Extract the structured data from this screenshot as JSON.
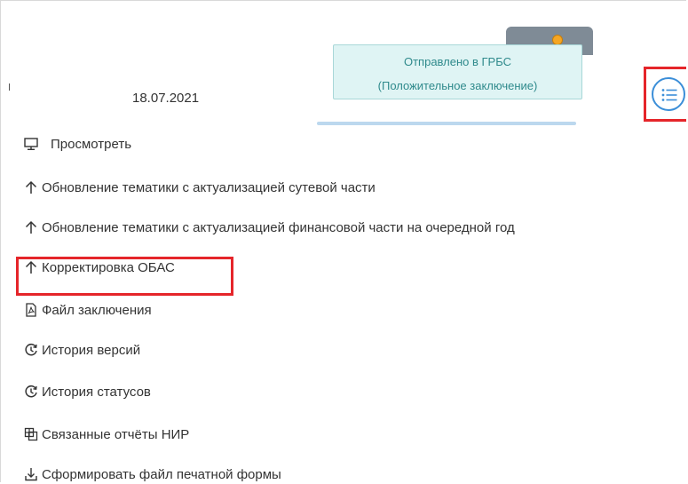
{
  "row": {
    "date": "18.07.2021",
    "status": {
      "line1": "Отправлено в ГРБС",
      "line2": "(Положительное заключение)",
      "color": "#2f8a8c",
      "dot_color": "#f5a623"
    },
    "menu_button_icon": "list-menu-icon"
  },
  "menu": {
    "items": [
      {
        "label": "Просмотреть",
        "icon": "monitor-icon"
      },
      {
        "label": "Обновление тематики с актуализацией сутевой части",
        "icon": "arrow-up-icon"
      },
      {
        "label": "Обновление тематики с актуализацией финансовой части на очередной год",
        "icon": "arrow-up-icon"
      },
      {
        "label": "Корректировка ОБАС",
        "icon": "arrow-up-icon",
        "highlighted": true
      },
      {
        "label": "Файл заключения",
        "icon": "pdf-file-icon"
      },
      {
        "label": "История версий",
        "icon": "history-icon"
      },
      {
        "label": "История статусов",
        "icon": "history-icon"
      },
      {
        "label": "Связанные отчёты НИР",
        "icon": "linked-copy-icon"
      },
      {
        "label": "Сформировать файл печатной формы",
        "icon": "download-icon"
      }
    ]
  },
  "colors": {
    "highlight": "#e5252a",
    "accent": "#3b8ed8"
  }
}
